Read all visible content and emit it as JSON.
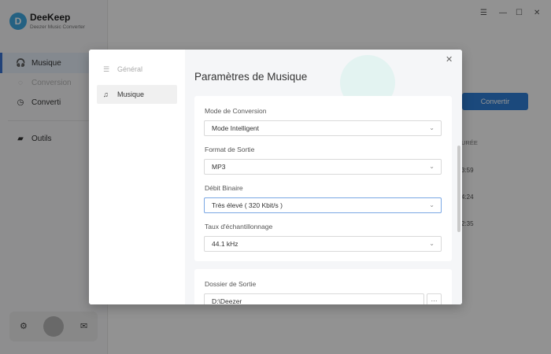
{
  "app": {
    "name": "DeeKeep",
    "subtitle": "Deezer Music Converter",
    "logo_letter": "D"
  },
  "sidebar": {
    "items": [
      {
        "label": "Musique",
        "icon": "headphones-icon"
      },
      {
        "label": "Conversion",
        "icon": "conversion-icon"
      },
      {
        "label": "Converti",
        "icon": "clock-icon"
      },
      {
        "label": "Outils",
        "icon": "toolbox-icon"
      }
    ]
  },
  "window": {
    "menu_glyph": "☰",
    "minimize_glyph": "—",
    "maximize_glyph": "☐",
    "close_glyph": "✕"
  },
  "main": {
    "convert_label": "Convertir",
    "duration_header": "URÉE",
    "durations": [
      "3:59",
      "4:24",
      "2:35"
    ]
  },
  "modal": {
    "title": "Paramètres de Musique",
    "close_glyph": "✕",
    "nav": [
      {
        "label": "Général",
        "icon": "sliders-icon"
      },
      {
        "label": "Musique",
        "icon": "music-note-icon"
      }
    ],
    "fields": {
      "conversion_mode": {
        "label": "Mode de Conversion",
        "value": "Mode Intelligent"
      },
      "output_format": {
        "label": "Format de Sortie",
        "value": "MP3"
      },
      "bitrate": {
        "label": "Débit Binaire",
        "value": "Très élevé ( 320 Kbit/s )"
      },
      "sample_rate": {
        "label": "Taux d'échantillonnage",
        "value": "44.1 kHz"
      },
      "output_folder": {
        "label": "Dossier de Sortie",
        "value": "D:\\Deezer",
        "browse_label": "···"
      }
    }
  },
  "colors": {
    "accent": "#2f7fd6",
    "active_nav": "#3a73d0"
  }
}
